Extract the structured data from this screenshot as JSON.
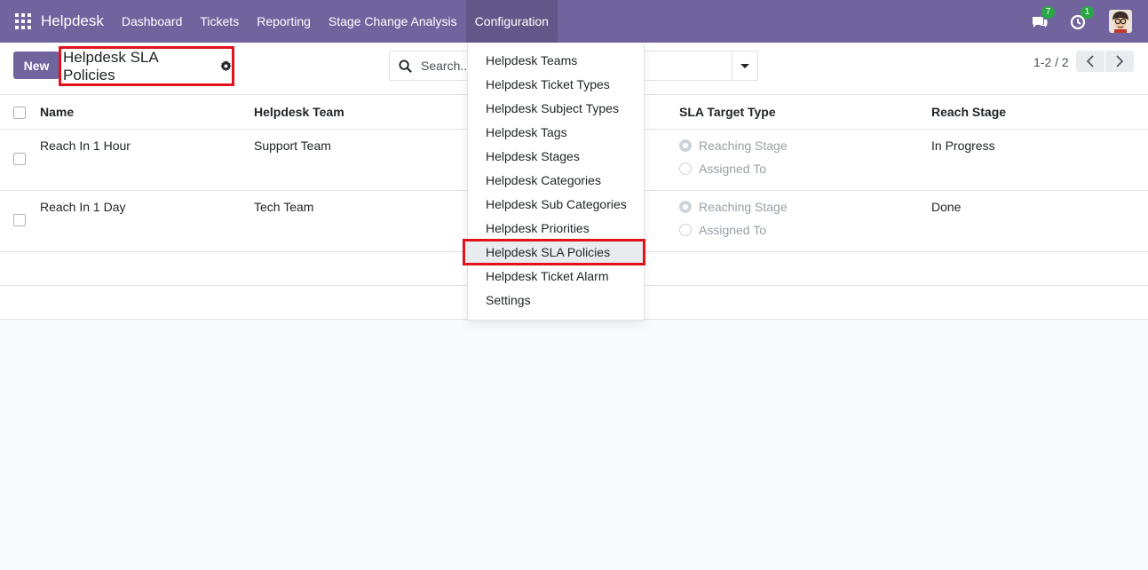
{
  "navbar": {
    "brand": "Helpdesk",
    "menu": [
      "Dashboard",
      "Tickets",
      "Reporting",
      "Stage Change Analysis",
      "Configuration"
    ],
    "active_menu": "Configuration",
    "messages_count": "7",
    "activities_count": "1",
    "icons": [
      "apps-grid-icon",
      "chat-icon",
      "clock-icon",
      "user-avatar"
    ]
  },
  "control_panel": {
    "new_label": "New",
    "title": "Helpdesk SLA Policies",
    "search_placeholder": "Search...",
    "pager": "1-2 / 2"
  },
  "table": {
    "columns": [
      "Name",
      "Helpdesk Team",
      "SLA Target Type",
      "Reach Stage"
    ],
    "rows": [
      {
        "name": "Reach In 1 Hour",
        "team": "Support Team",
        "target_options": [
          "Reaching Stage",
          "Assigned To"
        ],
        "selected": "Reaching Stage",
        "reach_stage": "In Progress"
      },
      {
        "name": "Reach In 1 Day",
        "team": "Tech Team",
        "target_options": [
          "Reaching Stage",
          "Assigned To"
        ],
        "selected": "Reaching Stage",
        "reach_stage": "Done"
      }
    ]
  },
  "configuration_menu": {
    "items": [
      "Helpdesk Teams",
      "Helpdesk Ticket Types",
      "Helpdesk Subject Types",
      "Helpdesk Tags",
      "Helpdesk Stages",
      "Helpdesk Categories",
      "Helpdesk Sub Categories",
      "Helpdesk Priorities",
      "Helpdesk SLA Policies",
      "Helpdesk Ticket Alarm",
      "Settings"
    ],
    "highlighted": "Helpdesk SLA Policies"
  },
  "colors": {
    "navbar": "#71639e",
    "primary_button": "#71639e",
    "highlight_box": "#e3111a",
    "badge": "#28a745"
  }
}
